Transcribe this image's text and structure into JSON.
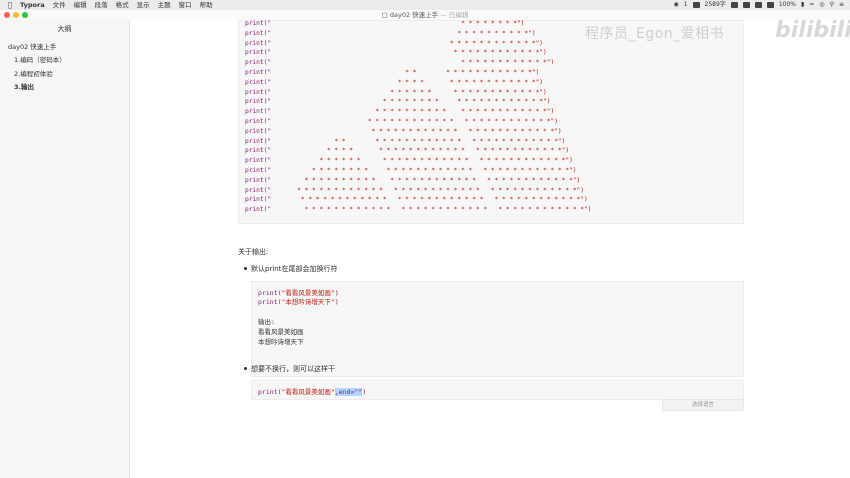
{
  "menubar": {
    "app": "Typora",
    "menus": [
      "文件",
      "编辑",
      "段落",
      "格式",
      "显示",
      "主题",
      "窗口",
      "帮助"
    ],
    "wechat_count": "1",
    "word_count": "2589字",
    "battery": "100%"
  },
  "window": {
    "title": "day02 快速上手",
    "status": "— 已编辑"
  },
  "sidebar": {
    "title": "大纲",
    "items": [
      "day02 快速上手",
      "1.编码（密码本）",
      "2.编程初体验",
      "3.输出"
    ]
  },
  "code1": {
    "prefix": "print(\"",
    "suffix": "\")",
    "lines": [
      "                                                   * * * * * * * *",
      "                                                  * * * * * * * * * *",
      "                                                * * * * * * * * * * * *",
      "                                                 * * * * * * * * * * * *",
      "                                                   * * * * * * * * * * * *",
      "                                    * *        * * * * * * * * * * * *",
      "                                  * * * *       * * * * * * * * * * * *",
      "                                * * * * * *      * * * * * * * * * * * *",
      "                              * * * * * * * *     * * * * * * * * * * * *",
      "                            * * * * * * * * * *    * * * * * * * * * * * *",
      "                          * * * * * * * * * * * *   * * * * * * * * * * * *",
      "                           * * * * * * * * * * * *   * * * * * * * * * * * *",
      "                 * *        * * * * * * * * * * * *   * * * * * * * * * * * *",
      "               * * * *       * * * * * * * * * * * *   * * * * * * * * * * * *",
      "             * * * * * *      * * * * * * * * * * * *   * * * * * * * * * * * *",
      "           * * * * * * * *     * * * * * * * * * * * *   * * * * * * * * * * * *",
      "         * * * * * * * * * *    * * * * * * * * * * * *   * * * * * * * * * * * *",
      "       * * * * * * * * * * * *   * * * * * * * * * * * *   * * * * * * * * * * * *",
      "        * * * * * * * * * * * *   * * * * * * * * * * * *   * * * * * * * * * * * *",
      "         * * * * * * * * * * * *   * * * * * * * * * * * *   * * * * * * * * * * * *"
    ]
  },
  "watermark": {
    "text": "程序员_Egon_爱相书",
    "logo": "bilibili"
  },
  "section": {
    "heading": "关于输出:",
    "bullet1": "默认print在尾部会加换行符",
    "code2": {
      "line1_fn": "print(",
      "line1_str": "\"看看风景美如画\"",
      "line1_end": ")",
      "line2_fn": "print(",
      "line2_str": "\"本想吟诗增天下\"",
      "line2_end": ")",
      "out_label": "输出:",
      "out1": "看看风景美如画",
      "out2": "本想吟诗增天下"
    },
    "bullet2": "想要不换行，则可以这样干",
    "code3": {
      "fn": "print(",
      "str": "\"看看风景美如画\"",
      "sel": ",end=\"\"",
      "end": ")"
    },
    "lang_button": "选择语言"
  }
}
